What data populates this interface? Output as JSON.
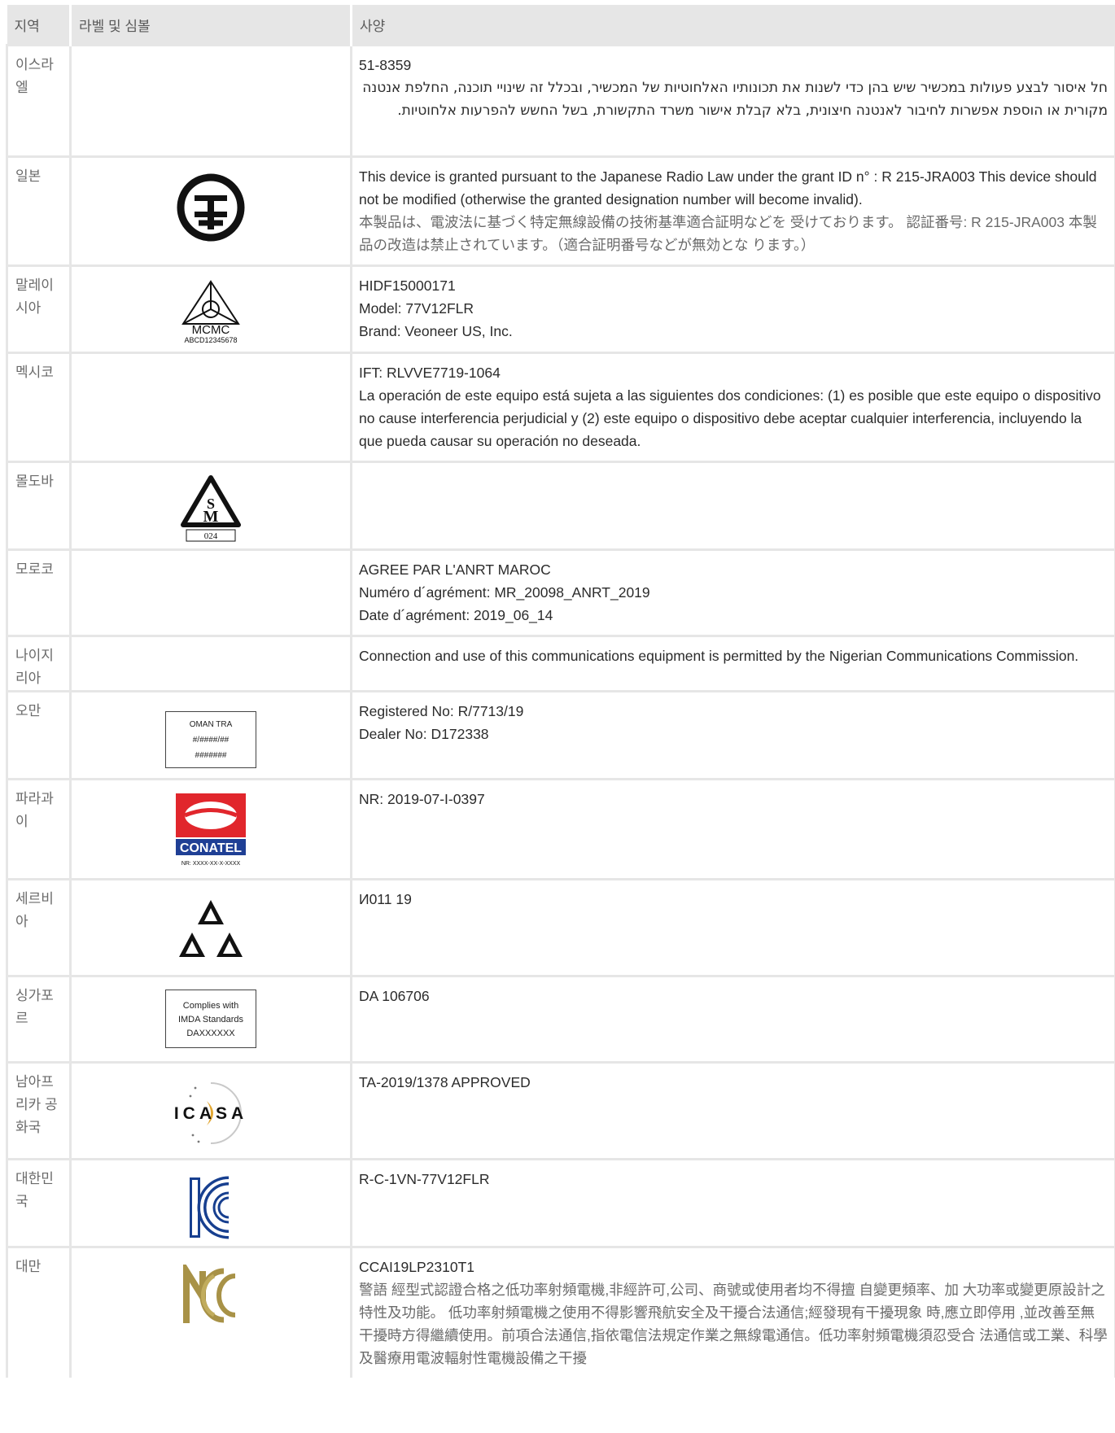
{
  "table": {
    "headers": {
      "region": "지역",
      "label": "라벨 및 심볼",
      "spec": "사양"
    },
    "rows": [
      {
        "region": "이스라엘",
        "spec": [
          "51-8359",
          "חל איסור לבצע פעולות במכשיר שיש בהן כדי לשנות את תכונותיו האלחוטיות של המכשיר, ובכלל זה שינויי תוכנה, החלפת אנטנה מקורית או הוספת אפשרות לחיבור לאנטנה חיצונית, בלא קבלת אישור משרד התקשורת, בשל החשש להפרעות אלחוטיות."
        ]
      },
      {
        "region": "일본",
        "spec": [
          "This device is granted pursuant to the Japanese Radio Law under the grant ID n° : R 215-JRA003 This device should not be modified (otherwise the granted designation number will become invalid).",
          "本製品は、電波法に基づく特定無線設備の技術基準適合証明などを 受けております。 認証番号: R 215-JRA003 本製品の改造は禁止されています。（適合証明番号などが無効とな ります。）"
        ]
      },
      {
        "region": "말레이시아",
        "label_text": {
          "brand": "MCMC",
          "code": "ABCD12345678"
        },
        "spec": [
          "HIDF15000171",
          "Model: 77V12FLR",
          "Brand: Veoneer US, Inc."
        ]
      },
      {
        "region": "멕시코",
        "spec": [
          "IFT: RLVVE7719-1064",
          "La operación de este equipo está sujeta a las siguientes dos condiciones: (1) es posible que este equipo o dispositivo no cause interferencia perjudicial y (2) este equipo o dispositivo debe aceptar cualquier interferencia, incluyendo la que pueda causar su operación no deseada."
        ]
      },
      {
        "region": "몰도바",
        "label_text": {
          "code": "024"
        },
        "spec": []
      },
      {
        "region": "모로코",
        "spec": [
          "AGREE PAR L'ANRT MAROC",
          "Numéro d´agrément: MR_20098_ANRT_2019",
          "Date d´agrément: 2019_06_14"
        ]
      },
      {
        "region": "나이지리아",
        "spec": [
          "Connection and use of this communications equipment is permitted by the Nigerian Communications Commission."
        ]
      },
      {
        "region": "오만",
        "label_text": {
          "line1": "OMAN TRA",
          "line2": "#/####/##",
          "line3": "#######"
        },
        "spec": [
          "Registered No: R/7713/19",
          "Dealer No: D172338"
        ]
      },
      {
        "region": "파라과이",
        "label_text": {
          "brand": "CONATEL",
          "code": "NR: XXXX-XX-X-XXXX"
        },
        "spec": [
          "NR: 2019-07-I-0397"
        ]
      },
      {
        "region": "세르비아",
        "spec": [
          "И011 19"
        ]
      },
      {
        "region": "싱가포르",
        "label_text": {
          "line1": "Complies with",
          "line2": "IMDA Standards",
          "line3": "DAXXXXXX"
        },
        "spec": [
          "DA 106706"
        ]
      },
      {
        "region": "남아프리카 공화국",
        "label_text": {
          "brand": "ICASA"
        },
        "spec": [
          "TA-2019/1378 APPROVED"
        ]
      },
      {
        "region": "대한민국",
        "spec": [
          "R-C-1VN-77V12FLR"
        ]
      },
      {
        "region": "대만",
        "spec": [
          "CCAI19LP2310T1",
          "警語 經型式認證合格之低功率射頻電機,非經許可,公司、商號或使用者均不得擅 自變更頻率、加 大功率或變更原設計之特性及功能。 低功率射頻電機之使用不得影響飛航安全及干擾合法通信;經發現有干擾現象 時,應立即停用 ,並改善至無干擾時方得繼續使用。前項合法通信,指依電信法規定作業之無線電通信。低功率射頻電機須忍受合 法通信或工業、科學及醫療用電波輻射性電機設備之干擾"
        ]
      }
    ]
  }
}
